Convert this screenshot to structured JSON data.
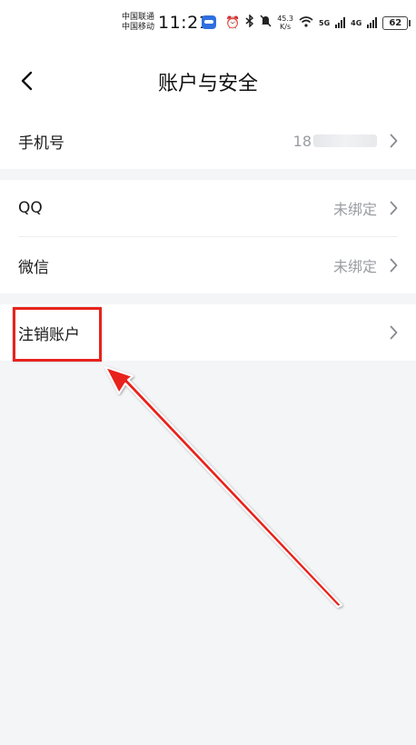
{
  "status_bar": {
    "carrier_top": "中国联通",
    "carrier_bottom": "中国移动",
    "time": "11:21",
    "net_speed_value": "45.3",
    "net_speed_unit": "K/s",
    "net_5g": "5G",
    "net_4g": "4G",
    "battery": "62",
    "icons": [
      "app-icon",
      "alarm-icon",
      "bluetooth-icon",
      "mute-icon",
      "wifi-icon",
      "signal-icon",
      "signal-icon",
      "battery-icon"
    ]
  },
  "header": {
    "title": "账户与安全",
    "back_icon": "chevron-left-icon"
  },
  "rows": {
    "phone": {
      "label": "手机号",
      "value_prefix": "18"
    },
    "qq": {
      "label": "QQ",
      "value": "未绑定"
    },
    "wechat": {
      "label": "微信",
      "value": "未绑定"
    },
    "cancel_account": {
      "label": "注销账户"
    }
  },
  "colors": {
    "background": "#f4f5f7",
    "card": "#ffffff",
    "secondary_text": "#9a9ca3",
    "annotation": "#e8231c"
  }
}
